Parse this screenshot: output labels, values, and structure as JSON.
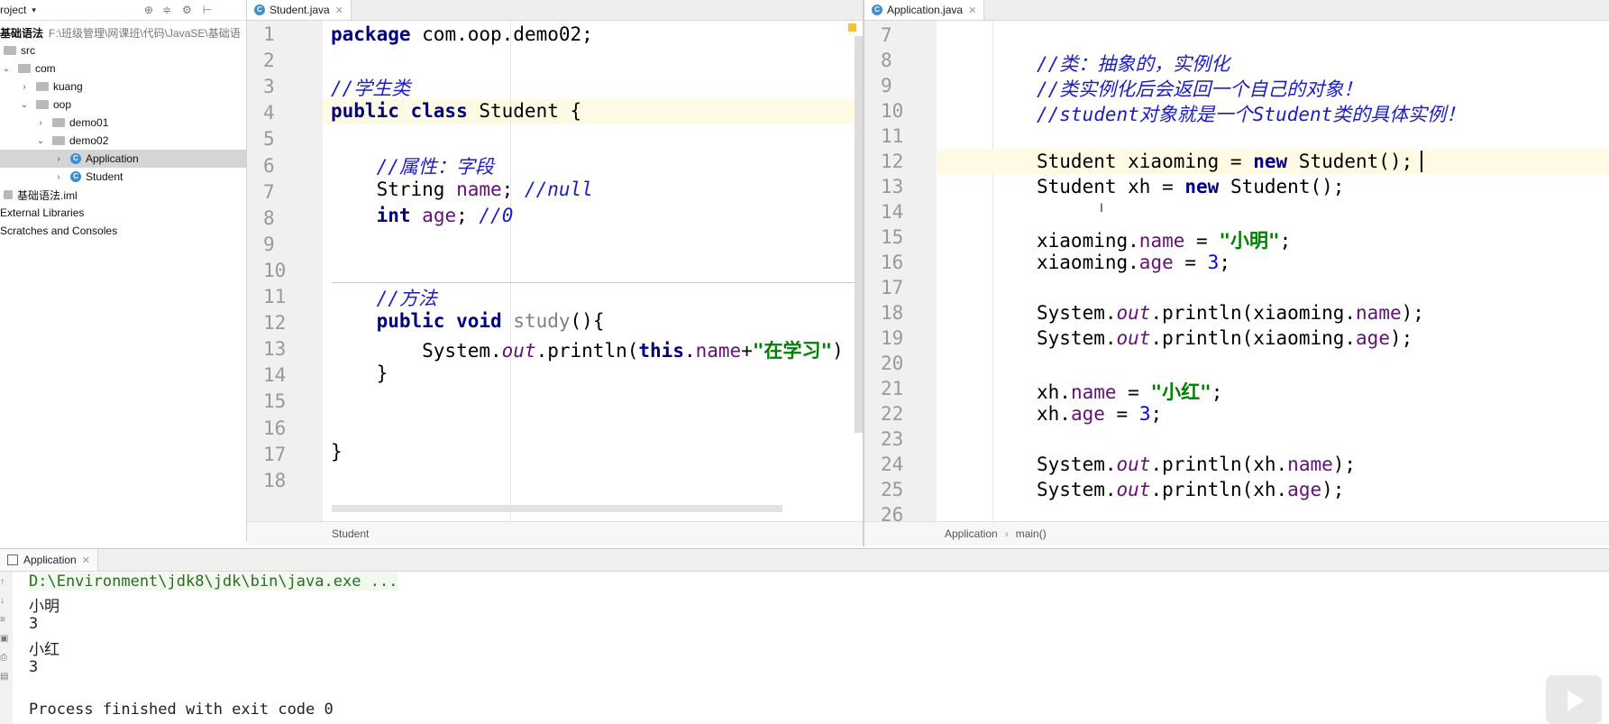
{
  "project_panel": {
    "header": "roject",
    "tree": [
      {
        "label": "基础语法",
        "path": "F:\\班级管理\\网课班\\代码\\JavaSE\\基础语",
        "indent": 0
      },
      {
        "label": "src",
        "indent": 0
      },
      {
        "label": "com",
        "indent": 1
      },
      {
        "label": "kuang",
        "indent": 2
      },
      {
        "label": "oop",
        "indent": 2
      },
      {
        "label": "demo01",
        "indent": 3
      },
      {
        "label": "demo02",
        "indent": 3
      },
      {
        "label": "Application",
        "indent": 4
      },
      {
        "label": "Student",
        "indent": 4
      },
      {
        "label": "基础语法.iml",
        "indent": 0
      },
      {
        "label": "External Libraries",
        "indent": 0
      },
      {
        "label": "Scratches and Consoles",
        "indent": 0
      }
    ]
  },
  "left_editor": {
    "tab": "Student.java",
    "line_numbers": [
      "1",
      "2",
      "3",
      "4",
      "5",
      "6",
      "7",
      "8",
      "9",
      "10",
      "11",
      "12",
      "13",
      "14",
      "15",
      "16",
      "17",
      "18"
    ],
    "breadcrumb": "Student"
  },
  "right_editor": {
    "tab": "Application.java",
    "line_numbers": [
      "7",
      "8",
      "9",
      "10",
      "11",
      "12",
      "13",
      "14",
      "15",
      "16",
      "17",
      "18",
      "19",
      "20",
      "21",
      "22",
      "23",
      "24",
      "25",
      "26"
    ],
    "breadcrumb": [
      "Application",
      "main()"
    ]
  },
  "run_panel": {
    "tab": "Application",
    "output": [
      "D:\\Environment\\jdk8\\jdk\\bin\\java.exe ...",
      "小明",
      "3",
      "小红",
      "3",
      "",
      "Process finished with exit code 0"
    ]
  },
  "colors": {
    "keyword": "#000080",
    "comment": "#1c1cc4",
    "string": "#008000",
    "field": "#660e7a",
    "number": "#0000ff"
  }
}
